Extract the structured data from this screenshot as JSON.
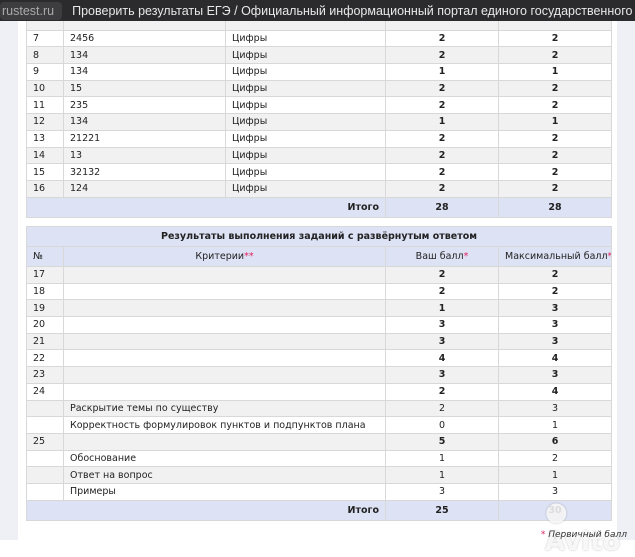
{
  "titlebar": {
    "site": "rustest.ru",
    "title": "Проверить результаты ЕГЭ / Официальный информационный портал единого государственного экзамена (ЕГЭ 2..."
  },
  "short_answers": {
    "rows": [
      {
        "n": "7",
        "answer": "2456",
        "type": "Цифры",
        "score": "2",
        "max": "2"
      },
      {
        "n": "8",
        "answer": "134",
        "type": "Цифры",
        "score": "2",
        "max": "2"
      },
      {
        "n": "9",
        "answer": "134",
        "type": "Цифры",
        "score": "1",
        "max": "1"
      },
      {
        "n": "10",
        "answer": "15",
        "type": "Цифры",
        "score": "2",
        "max": "2"
      },
      {
        "n": "11",
        "answer": "235",
        "type": "Цифры",
        "score": "2",
        "max": "2"
      },
      {
        "n": "12",
        "answer": "134",
        "type": "Цифры",
        "score": "1",
        "max": "1"
      },
      {
        "n": "13",
        "answer": "21221",
        "type": "Цифры",
        "score": "2",
        "max": "2"
      },
      {
        "n": "14",
        "answer": "13",
        "type": "Цифры",
        "score": "2",
        "max": "2"
      },
      {
        "n": "15",
        "answer": "32132",
        "type": "Цифры",
        "score": "2",
        "max": "2"
      },
      {
        "n": "16",
        "answer": "124",
        "type": "Цифры",
        "score": "2",
        "max": "2"
      }
    ],
    "total_label": "Итого",
    "total_score": "28",
    "total_max": "28"
  },
  "extended": {
    "title": "Результаты выполнения заданий с развёрнутым ответом",
    "headers": {
      "n": "№",
      "criteria": "Критерии",
      "criteria_mark": "**",
      "score": "Ваш балл",
      "max": "Максимальный балл",
      "mark": "*"
    },
    "rows": [
      {
        "n": "17",
        "criteria": "",
        "score": "2",
        "max": "2",
        "bold": true
      },
      {
        "n": "18",
        "criteria": "",
        "score": "2",
        "max": "2",
        "bold": true
      },
      {
        "n": "19",
        "criteria": "",
        "score": "1",
        "max": "3",
        "bold": true
      },
      {
        "n": "20",
        "criteria": "",
        "score": "3",
        "max": "3",
        "bold": true
      },
      {
        "n": "21",
        "criteria": "",
        "score": "3",
        "max": "3",
        "bold": true
      },
      {
        "n": "22",
        "criteria": "",
        "score": "4",
        "max": "4",
        "bold": true
      },
      {
        "n": "23",
        "criteria": "",
        "score": "3",
        "max": "3",
        "bold": true
      },
      {
        "n": "24",
        "criteria": "",
        "score": "2",
        "max": "4",
        "bold": true
      },
      {
        "n": "",
        "criteria": "Раскрытие темы по существу",
        "score": "2",
        "max": "3",
        "bold": false
      },
      {
        "n": "",
        "criteria": "Корректность формулировок пунктов и подпунктов плана",
        "score": "0",
        "max": "1",
        "bold": false
      },
      {
        "n": "25",
        "criteria": "",
        "score": "5",
        "max": "6",
        "bold": true
      },
      {
        "n": "",
        "criteria": "Обоснование",
        "score": "1",
        "max": "2",
        "bold": false
      },
      {
        "n": "",
        "criteria": "Ответ на вопрос",
        "score": "1",
        "max": "1",
        "bold": false
      },
      {
        "n": "",
        "criteria": "Примеры",
        "score": "3",
        "max": "3",
        "bold": false
      }
    ],
    "total_label": "Итого",
    "total_score": "25",
    "total_max": "30"
  },
  "footnote": {
    "mark": "*",
    "text": " Первичный балл"
  },
  "watermark": "Avito"
}
